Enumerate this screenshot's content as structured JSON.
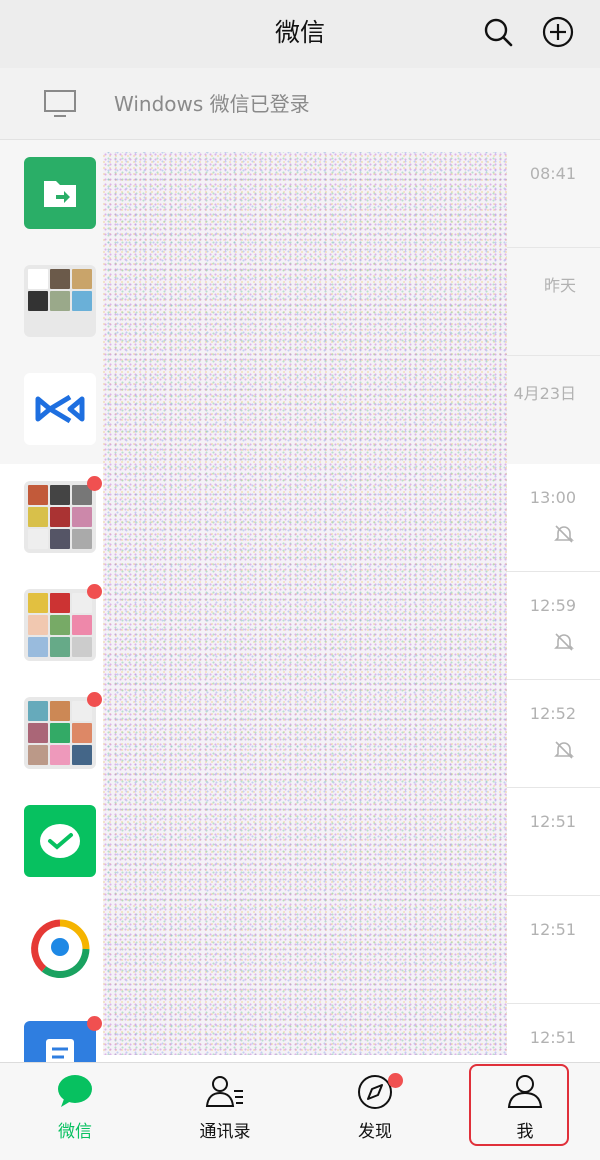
{
  "header": {
    "title": "微信",
    "search_icon": "search-icon",
    "add_icon": "plus-circle-icon"
  },
  "login_bar": {
    "icon": "monitor-icon",
    "text": "Windows 微信已登录"
  },
  "chats": [
    {
      "time": "08:41",
      "avatar": "folder-transfer-icon",
      "pinned": true
    },
    {
      "time": "昨天",
      "avatar": "group-grid",
      "pinned": true
    },
    {
      "time": "4月23日",
      "avatar": "app-logo",
      "pinned": true
    },
    {
      "time": "13:00",
      "avatar": "group-grid",
      "unread_dot": true,
      "muted": true
    },
    {
      "time": "12:59",
      "avatar": "group-grid",
      "unread_dot": true,
      "muted": true
    },
    {
      "time": "12:52",
      "avatar": "group-grid",
      "unread_dot": true,
      "muted": true
    },
    {
      "time": "12:51",
      "avatar": "wechat-pay-icon"
    },
    {
      "time": "12:51",
      "avatar": "news-icon"
    },
    {
      "time": "12:51",
      "avatar": "document-icon",
      "unread_dot": true
    }
  ],
  "tabs": [
    {
      "label": "微信",
      "icon": "chat-bubble-icon",
      "active": true
    },
    {
      "label": "通讯录",
      "icon": "contacts-icon"
    },
    {
      "label": "发现",
      "icon": "compass-icon",
      "badge": true
    },
    {
      "label": "我",
      "icon": "person-icon",
      "highlighted": true
    }
  ],
  "colors": {
    "accent": "#07c160",
    "badge": "#f05050",
    "highlight": "#e0303a",
    "header_bg": "#ededed"
  }
}
